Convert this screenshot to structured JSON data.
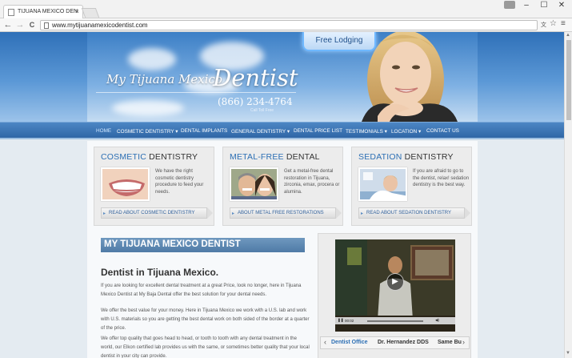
{
  "browser": {
    "tab_title": "TIJUANA MEXICO DEN",
    "tab_close": "×",
    "url": "www.mytijuanamexicodentist.com",
    "window_controls": [
      "–",
      "☐",
      "✕"
    ],
    "nav_back": "←",
    "nav_forward": "→",
    "nav_reload": "C",
    "star": "☆",
    "menu": "≡"
  },
  "header": {
    "logo_script": "My Tijuana Mexico",
    "logo_word": "Dentist",
    "phone": "(866) 234-4764",
    "toll_free": "Call Toll Free",
    "lodging_button": "Free Lodging"
  },
  "nav": {
    "items": [
      "HOME",
      "COSMETIC DENTISTRY ▾",
      "DENTAL IMPLANTS",
      "GENERAL DENTISTRY ▾",
      "DENTAL PRICE LIST",
      "TESTIMONIALS ▾",
      "LOCATION ▾",
      "CONTACT US"
    ]
  },
  "features": [
    {
      "title_highlight": "COSMETIC",
      "title_rest": " DENTISTRY",
      "description": "We have the right cosmetic dentistry procedure to feed your needs.",
      "button": "READ ABOUT COSMETIC DENTISTRY"
    },
    {
      "title_highlight": "METAL-FREE",
      "title_rest": " DENTAL",
      "description": "Get a metal-free dental restoration in Tijuana, zirconia, emax, procera or alumina.",
      "button": "ABOUT METAL FREE RESTORATIONS"
    },
    {
      "title_highlight": "SEDATION",
      "title_rest": " DENTISTRY",
      "description": "If you are afraid to go to the dentist, relax! sedation dentistry is the best way.",
      "button": "READ ABOUT SEDATION DENTISTRY"
    }
  ],
  "main": {
    "banner": "MY TIJUANA MEXICO DENTIST",
    "heading": "Dentist in Tijuana Mexico.",
    "paragraphs": [
      "If you are looking for excellent dental treatment at a great Price, look no longer, here in Tijuana Mexico Dentist at My Baja Dental offer the best solution for your dental needs.",
      "We offer the best value for your money.  Here in Tijuana Mexico we work with a U.S. lab and work with U.S. materials so you are getting the best dental work on both sided of the border at a quarter of the price.",
      "We offer top quality that goes head to head, or tooth to tooth with any dental treatment in the world, our Elkon certified lab provides us with the same, or sometimes better quality that your local dentist in your city can provide."
    ]
  },
  "video": {
    "time": "00:02",
    "tabs": [
      "Dentist Office",
      "Dr. Hernandez DDS",
      "Same Bu"
    ],
    "prev_arrow": "‹",
    "next_arrow": "›",
    "play": "▶"
  }
}
